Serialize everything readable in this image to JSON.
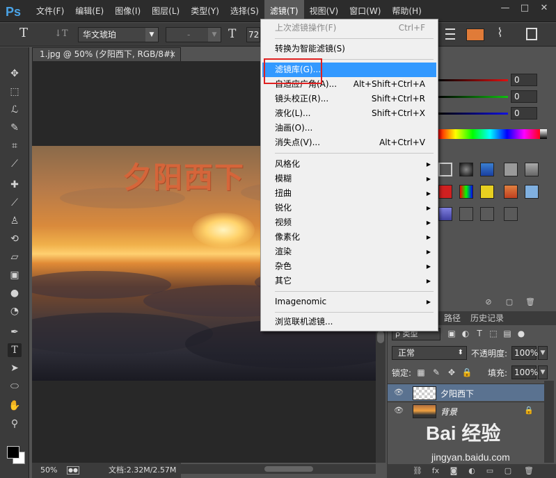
{
  "app": {
    "logo": "Ps",
    "menus": [
      "文件(F)",
      "编辑(E)",
      "图像(I)",
      "图层(L)",
      "类型(Y)",
      "选择(S)",
      "滤镜(T)",
      "视图(V)",
      "窗口(W)",
      "帮助(H)"
    ],
    "active_menu": "滤镜(T)",
    "window_controls": [
      "—",
      "□",
      "✕"
    ]
  },
  "options": {
    "tool_icon": "T",
    "orient_icon": "↓T",
    "font_family": "华文琥珀",
    "font_style": "-",
    "size_icon": "T",
    "size_value": "72",
    "color": "#e07b38"
  },
  "document": {
    "tab_title": "1.jpg @ 50% (夕阳西下, RGB/8#) *",
    "tab_close": "×",
    "canvas_text": "夕阳西下"
  },
  "status": {
    "zoom": "50%",
    "doc_size": "文档:2.32M/2.57M"
  },
  "filter_menu": {
    "items": [
      {
        "label": "上次滤镜操作(F)",
        "shortcut": "Ctrl+F",
        "disabled": true
      },
      {
        "label": "转换为智能滤镜(S)",
        "shortcut": ""
      },
      {
        "label": "滤镜库(G)...",
        "shortcut": "",
        "highlight": true
      },
      {
        "label": "自适应广角(A)...",
        "shortcut": "Alt+Shift+Ctrl+A"
      },
      {
        "label": "镜头校正(R)...",
        "shortcut": "Shift+Ctrl+R"
      },
      {
        "label": "液化(L)...",
        "shortcut": "Shift+Ctrl+X"
      },
      {
        "label": "油画(O)...",
        "shortcut": ""
      },
      {
        "label": "消失点(V)...",
        "shortcut": "Alt+Ctrl+V"
      },
      {
        "label": "风格化",
        "submenu": true
      },
      {
        "label": "模糊",
        "submenu": true
      },
      {
        "label": "扭曲",
        "submenu": true
      },
      {
        "label": "锐化",
        "submenu": true
      },
      {
        "label": "视频",
        "submenu": true
      },
      {
        "label": "像素化",
        "submenu": true
      },
      {
        "label": "渲染",
        "submenu": true
      },
      {
        "label": "杂色",
        "submenu": true
      },
      {
        "label": "其它",
        "submenu": true
      },
      {
        "label": "Imagenomic",
        "submenu": true
      },
      {
        "label": "浏览联机滤镜...",
        "shortcut": ""
      }
    ],
    "submenu_arrow": "▶"
  },
  "color_panel": {
    "values": [
      "0",
      "0",
      "0"
    ],
    "slider_colors": [
      "#e01010",
      "#10c010",
      "#1010e0"
    ]
  },
  "layers": {
    "tabs": [
      "路径",
      "历史记录"
    ],
    "kind_filter": "ρ 类型",
    "blend_mode": "正常",
    "opacity_label": "不透明度:",
    "opacity_value": "100%",
    "lock_label": "锁定:",
    "fill_label": "填充:",
    "fill_value": "100%",
    "rows": [
      {
        "name": "夕阳西下",
        "selected": true
      },
      {
        "name": "背景",
        "locked": true
      }
    ],
    "footer_icons": [
      "link-icon",
      "fx-icon",
      "mask-icon",
      "adjustment-icon",
      "folder-icon",
      "new-layer-icon",
      "trash-icon"
    ]
  },
  "watermark": {
    "logo": "Bai 经验",
    "url": "jingyan.baidu.com"
  }
}
